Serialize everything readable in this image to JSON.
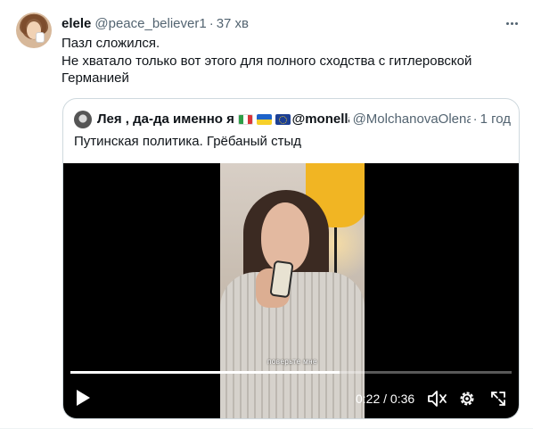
{
  "tweet": {
    "author_name": "elele",
    "author_handle": "@peace_believer1",
    "separator": "·",
    "time": "37 хв",
    "text_lines": [
      "Пазл сложился.",
      "Не хватало только вот этого для полного сходства с гитлеровской",
      "Германией"
    ],
    "more_icon": "more-horizontal-icon"
  },
  "quote": {
    "author_name": "Лея , да-да именно я",
    "author_name_suffix": "@monella",
    "flags": [
      "italy-flag",
      "ukraine-flag",
      "eu-flag"
    ],
    "author_handle": "@MolchanovaOlena",
    "separator": "·",
    "time": "1 год",
    "text": "Путинская политика. Грёбаный стыд",
    "video": {
      "subtitle": "поверьте мне",
      "progress": 0.6111,
      "time_display": "0:22 / 0:36",
      "controls": [
        "play-icon",
        "mute-icon",
        "settings-icon",
        "fullscreen-icon"
      ]
    }
  },
  "colors": {
    "text_primary": "#0f1419",
    "text_secondary": "#536471",
    "border": "#cfd9de",
    "video_bg": "#000000",
    "lamp": "#f1b523"
  }
}
